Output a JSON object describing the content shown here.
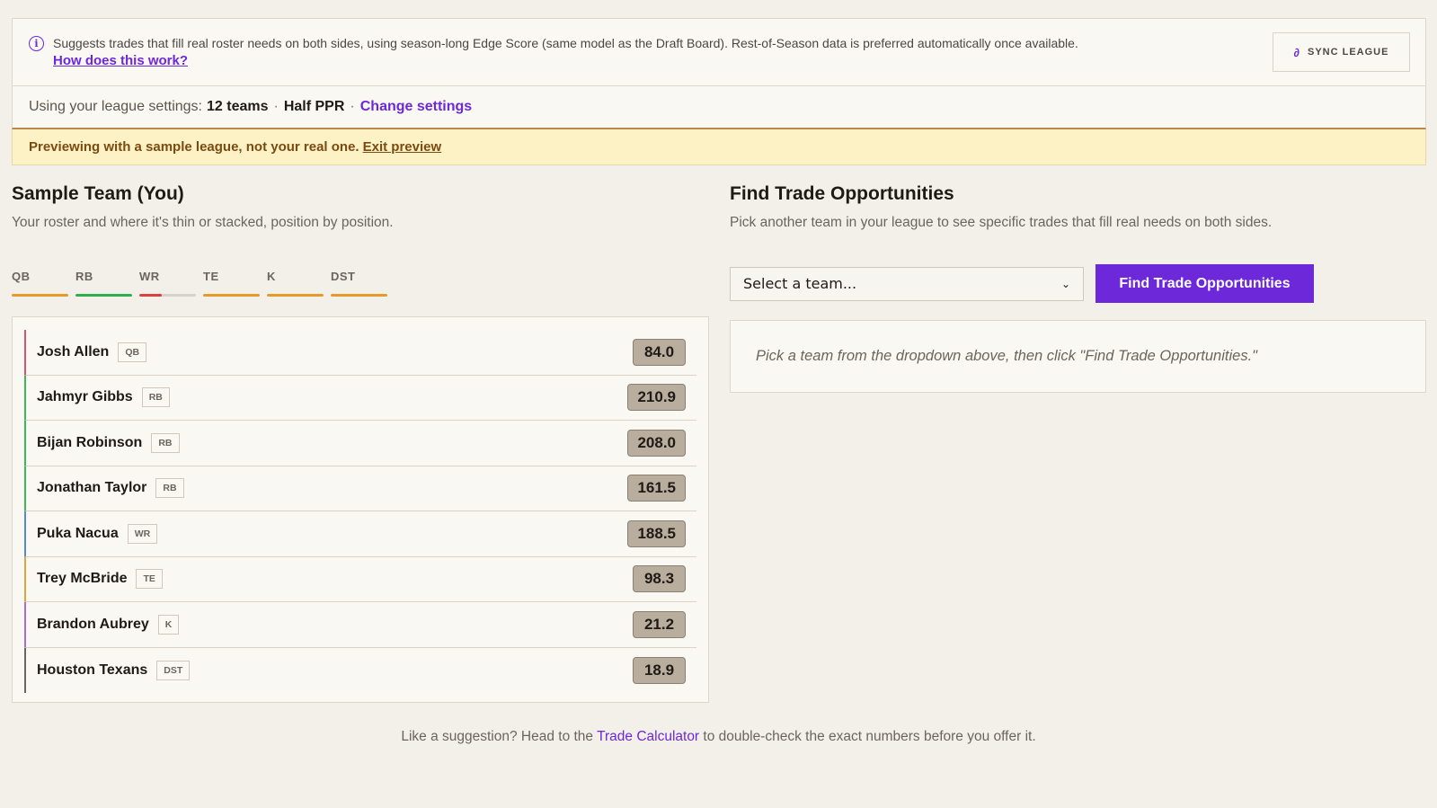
{
  "banner": {
    "icon": "info-icon",
    "text": "Suggests trades that fill real roster needs on both sides, using season-long Edge Score (same model as the Draft Board). Rest-of-Season data is preferred automatically once available.",
    "link": "How does this work?",
    "sync_label": "SYNC LEAGUE"
  },
  "settings": {
    "prefix": "Using your league settings:",
    "teams": "12 teams",
    "scoring": "Half PPR",
    "change_label": "Change settings"
  },
  "preview": {
    "text": "Previewing with a sample league, not your real one.",
    "exit_label": "Exit preview"
  },
  "team": {
    "title": "Sample Team (You)",
    "subtitle": "Your roster and where it's thin or stacked, position by position.",
    "positions": [
      {
        "label": "QB",
        "color": "#e59a2a",
        "strength": 1.0
      },
      {
        "label": "RB",
        "color": "#2fae4e",
        "strength": 1.0
      },
      {
        "label": "WR",
        "color": "#dc4040",
        "strength": 0.4
      },
      {
        "label": "TE",
        "color": "#e59a2a",
        "strength": 1.0
      },
      {
        "label": "K",
        "color": "#e59a2a",
        "strength": 1.0
      },
      {
        "label": "DST",
        "color": "#e59a2a",
        "strength": 1.0
      }
    ],
    "roster": [
      {
        "name": "Josh Allen",
        "pos": "QB",
        "score": "84.0",
        "color": "#d8536b"
      },
      {
        "name": "Jahmyr Gibbs",
        "pos": "RB",
        "score": "210.9",
        "color": "#3fb45c"
      },
      {
        "name": "Bijan Robinson",
        "pos": "RB",
        "score": "208.0",
        "color": "#3fb45c"
      },
      {
        "name": "Jonathan Taylor",
        "pos": "RB",
        "score": "161.5",
        "color": "#3fb45c"
      },
      {
        "name": "Puka Nacua",
        "pos": "WR",
        "score": "188.5",
        "color": "#5a86d6"
      },
      {
        "name": "Trey McBride",
        "pos": "TE",
        "score": "98.3",
        "color": "#e5a13a"
      },
      {
        "name": "Brandon Aubrey",
        "pos": "K",
        "score": "21.2",
        "color": "#a070d8"
      },
      {
        "name": "Houston Texans",
        "pos": "DST",
        "score": "18.9",
        "color": "#6b655d"
      }
    ]
  },
  "finder": {
    "title": "Find Trade Opportunities",
    "subtitle": "Pick another team in your league to see specific trades that fill real needs on both sides.",
    "select_value": "Select a team...",
    "button_label": "Find Trade Opportunities",
    "empty_text": "Pick a team from the dropdown above, then click \"Find Trade Opportunities.\""
  },
  "footer": {
    "before": "Like a suggestion? Head to the",
    "link": "Trade Calculator",
    "after": "to double-check the exact numbers before you offer it."
  }
}
